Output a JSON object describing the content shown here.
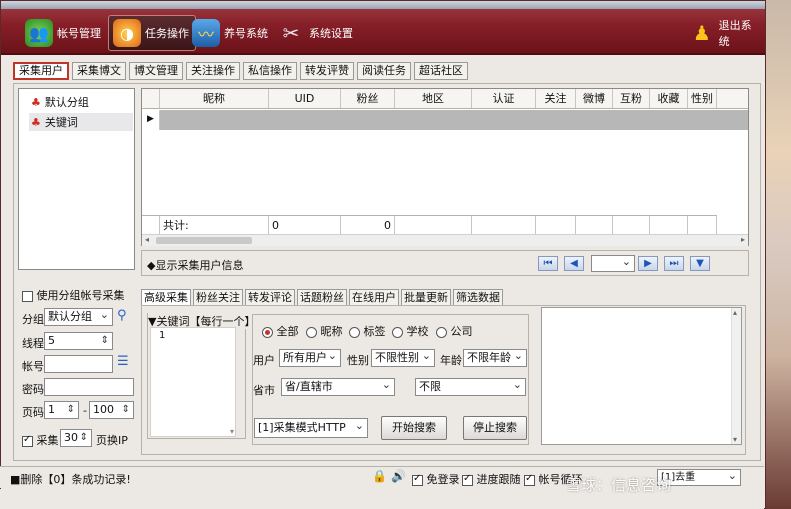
{
  "topnav": [
    {
      "label": "帐号管理",
      "icon": "account-icon",
      "active": false
    },
    {
      "label": "任务操作",
      "icon": "task-icon",
      "active": true
    },
    {
      "label": "养号系统",
      "icon": "chart-icon",
      "active": false
    },
    {
      "label": "系统设置",
      "icon": "tools-icon",
      "active": false
    }
  ],
  "logout_label": "退出系统",
  "tabs": [
    "采集用户",
    "采集博文",
    "博文管理",
    "关注操作",
    "私信操作",
    "转发评赞",
    "阅读任务",
    "超话社区"
  ],
  "tree": [
    "默认分组",
    "关键词"
  ],
  "grid": {
    "headers": [
      "昵称",
      "UID",
      "粉丝",
      "地区",
      "认证",
      "关注",
      "微博",
      "互粉",
      "收藏",
      "性别"
    ],
    "footer_label": "共计:",
    "footer_uid": "0",
    "footer_fans": "0"
  },
  "info_label": "◆显示采集用户信息",
  "left_panel": {
    "use_group_label": "使用分组帐号采集",
    "group_label": "分组",
    "group_value": "默认分组",
    "thread_label": "线程",
    "thread_value": "5",
    "account_label": "帐号",
    "password_label": "密码",
    "page_label": "页码",
    "page_from": "1",
    "page_sep": "-",
    "page_to": "100",
    "collect_label": "采集",
    "collect_value": "30",
    "switch_ip_label": "页换IP"
  },
  "subtabs": [
    "高级采集",
    "粉丝关注",
    "转发评论",
    "话题粉丝",
    "在线用户",
    "批量更新",
    "筛选数据"
  ],
  "keyword": {
    "label": "▼关键词【每行一个】",
    "line_no": "1"
  },
  "options": {
    "radios": [
      "全部",
      "昵称",
      "标签",
      "学校",
      "公司"
    ],
    "user_label": "用户",
    "user_value": "所有用户",
    "gender_label": "性别",
    "gender_value": "不限性别",
    "age_label": "年龄",
    "age_value": "不限年龄",
    "province_label": "省市",
    "province_value": "省/直辖市",
    "city_value": "不限",
    "mode_value": "[1]采集模式HTTP",
    "start_label": "开始搜索",
    "stop_label": "停止搜索"
  },
  "status": {
    "delete_text": "■删除【0】条成功记录!",
    "free_login": "免登录",
    "progress": "进度跟随",
    "account": "帐号循环",
    "interval": "[1]去重",
    "watermark": "雪球：信息咨询"
  }
}
